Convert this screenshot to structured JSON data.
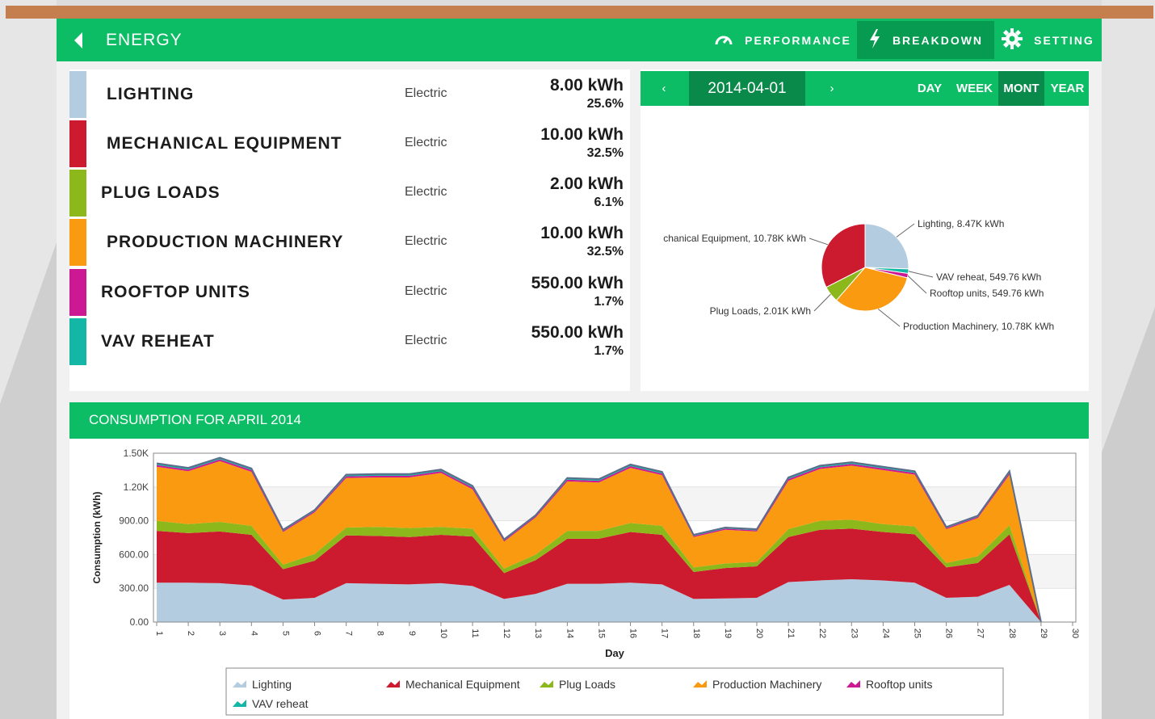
{
  "header": {
    "title": "ENERGY",
    "nav": [
      {
        "label": "PERFORMANCE",
        "icon": "gauge-icon"
      },
      {
        "label": "BREAKDOWN",
        "icon": "lightning-icon"
      },
      {
        "label": "SETTING",
        "icon": "gear-icon"
      }
    ],
    "active_nav": "BREAKDOWN"
  },
  "breakdown": [
    {
      "name": "LIGHTING",
      "type": "Electric",
      "value": "8.00 kWh",
      "percent": "25.6%",
      "color": "#b4cce0"
    },
    {
      "name": "MECHANICAL EQUIPMENT",
      "type": "Electric",
      "value": "10.00 kWh",
      "percent": "32.5%",
      "color": "#cc1a2e"
    },
    {
      "name": "PLUG LOADS",
      "type": "Electric",
      "value": "2.00 kWh",
      "percent": "6.1%",
      "color": "#8db81c"
    },
    {
      "name": "PRODUCTION MACHINERY",
      "type": "Electric",
      "value": "10.00 kWh",
      "percent": "32.5%",
      "color": "#fa9a10"
    },
    {
      "name": "ROOFTOP UNITS",
      "type": "Electric",
      "value": "550.00 kWh",
      "percent": "1.7%",
      "color": "#cc1893"
    },
    {
      "name": "VAV REHEAT",
      "type": "Electric",
      "value": "550.00 kWh",
      "percent": "1.7%",
      "color": "#14b7a5"
    }
  ],
  "date_nav": {
    "prev": "‹",
    "date": "2014-04-01",
    "next": "›",
    "periods": [
      "DAY",
      "WEEK",
      "MONT",
      "YEAR"
    ],
    "active_period": "MONT"
  },
  "chart_data": [
    {
      "type": "pie",
      "slices": [
        {
          "label": "Lighting, 8.47K kWh",
          "value": 8470,
          "color": "#b4cce0"
        },
        {
          "label": "VAV reheat, 549.76 kWh",
          "value": 549.76,
          "color": "#14b7a5"
        },
        {
          "label": "Rooftop units, 549.76 kWh",
          "value": 549.76,
          "color": "#cc1893"
        },
        {
          "label": "Production Machinery, 10.78K kWh",
          "value": 10780,
          "color": "#fa9a10"
        },
        {
          "label": "Plug Loads, 2.01K kWh",
          "value": 2010,
          "color": "#8db81c"
        },
        {
          "label": "chanical Equipment, 10.78K kWh",
          "value": 10780,
          "color": "#cc1a2e"
        }
      ]
    },
    {
      "type": "area",
      "title": "CONSUMPTION FOR APRIL 2014",
      "xlabel": "Day",
      "ylabel": "Consumption (kWh)",
      "ylim": [
        0,
        1500
      ],
      "yticks": [
        "0.00",
        "300.00",
        "600.00",
        "900.00",
        "1.20K",
        "1.50K"
      ],
      "x": [
        "1",
        "2",
        "3",
        "4",
        "5",
        "6",
        "7",
        "8",
        "9",
        "10",
        "11",
        "12",
        "13",
        "14",
        "15",
        "16",
        "17",
        "18",
        "19",
        "20",
        "21",
        "22",
        "23",
        "24",
        "25",
        "26",
        "27",
        "28",
        "29",
        "30"
      ],
      "series": [
        {
          "name": "Lighting",
          "color": "#b4cce0",
          "values": [
            350,
            350,
            345,
            325,
            200,
            215,
            345,
            340,
            335,
            345,
            320,
            205,
            250,
            340,
            340,
            350,
            335,
            205,
            210,
            215,
            355,
            370,
            380,
            370,
            350,
            215,
            225,
            330,
            0
          ]
        },
        {
          "name": "Mechanical Equipment",
          "color": "#cc1a2e",
          "values": [
            460,
            440,
            460,
            450,
            270,
            330,
            425,
            425,
            420,
            430,
            440,
            230,
            300,
            400,
            400,
            450,
            440,
            240,
            270,
            280,
            400,
            450,
            450,
            430,
            430,
            270,
            300,
            450,
            0
          ]
        },
        {
          "name": "Plug Loads",
          "color": "#8db81c",
          "values": [
            90,
            80,
            85,
            80,
            40,
            60,
            70,
            80,
            80,
            70,
            70,
            40,
            50,
            70,
            70,
            80,
            80,
            40,
            40,
            40,
            70,
            80,
            80,
            70,
            70,
            40,
            60,
            80,
            0
          ]
        },
        {
          "name": "Production Machinery",
          "color": "#fa9a10",
          "values": [
            480,
            470,
            540,
            480,
            290,
            370,
            440,
            440,
            450,
            480,
            350,
            240,
            330,
            440,
            430,
            490,
            450,
            270,
            300,
            270,
            430,
            460,
            480,
            480,
            460,
            300,
            340,
            450,
            0
          ]
        },
        {
          "name": "Rooftop units",
          "color": "#cc1893",
          "values": [
            15,
            15,
            15,
            15,
            10,
            10,
            15,
            15,
            15,
            15,
            15,
            10,
            10,
            15,
            15,
            15,
            15,
            10,
            10,
            10,
            15,
            15,
            15,
            15,
            15,
            10,
            10,
            15,
            0
          ]
        },
        {
          "name": "VAV reheat",
          "color": "#14b7a5",
          "values": [
            15,
            15,
            15,
            15,
            10,
            10,
            15,
            15,
            15,
            15,
            15,
            10,
            10,
            15,
            15,
            15,
            15,
            10,
            10,
            10,
            15,
            15,
            15,
            15,
            15,
            10,
            10,
            15,
            0
          ]
        }
      ],
      "grid": true,
      "legend_position": "bottom"
    }
  ]
}
